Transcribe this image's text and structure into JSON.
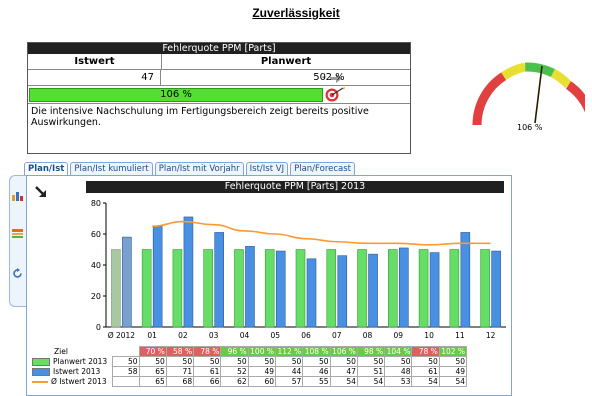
{
  "page_title": "Zuverlässigkeit",
  "kpi": {
    "header": "Fehlerquote PPM [Parts]",
    "col_istwert": "Istwert",
    "col_planwert": "Planwert",
    "istwert": "47",
    "planwert": "50",
    "delta": "-2 %",
    "progress_label": "106 %",
    "progress_fraction": 1.0,
    "comment": "Die intensive Nachschulung im Fertigungsbereich zeigt bereits positive Auswirkungen."
  },
  "gauge": {
    "label": "106 %",
    "value_percent": 106,
    "colors": {
      "red": "#e04040",
      "yellow": "#e8e030",
      "green": "#4cc04c"
    }
  },
  "tabs": [
    "Plan/Ist",
    "Plan/Ist kumuliert",
    "Plan/Ist mit Vorjahr",
    "Ist/Ist VJ",
    "Plan/Forecast"
  ],
  "active_tab": "Plan/Ist",
  "chart_data": {
    "type": "bar",
    "title": "Fehlerquote PPM [Parts] 2013",
    "categories": [
      "Ø 2012",
      "01",
      "02",
      "03",
      "04",
      "05",
      "06",
      "07",
      "08",
      "09",
      "10",
      "11",
      "12"
    ],
    "ylim": [
      0,
      80
    ],
    "yticks": [
      0,
      20,
      40,
      60,
      80
    ],
    "series": [
      {
        "name": "Planwert 2013",
        "color": "#66dd66",
        "values": [
          50,
          50,
          50,
          50,
          50,
          50,
          50,
          50,
          50,
          50,
          50,
          50,
          50
        ]
      },
      {
        "name": "Istwert 2013",
        "color": "#4a90e2",
        "values": [
          58,
          65,
          71,
          61,
          52,
          49,
          44,
          46,
          47,
          51,
          48,
          61,
          49
        ]
      },
      {
        "name": "Ø Istwert 2013",
        "color": "#ff9933",
        "type": "line",
        "values": [
          null,
          65,
          68,
          66,
          62,
          60,
          57,
          55,
          54,
          54,
          53,
          54,
          54
        ]
      }
    ],
    "ziel": {
      "label": "Ziel",
      "values": [
        "",
        "70 %",
        "58 %",
        "78 %",
        "96 %",
        "100 %",
        "112 %",
        "108 %",
        "106 %",
        "98 %",
        "104 %",
        "78 %",
        "102 %"
      ],
      "status": [
        "none",
        "red",
        "red",
        "red",
        "green",
        "green",
        "green",
        "green",
        "green",
        "green",
        "green",
        "red",
        "green"
      ]
    },
    "table_rows": [
      {
        "label": "Planwert 2013",
        "values": [
          "50",
          "50",
          "50",
          "50",
          "50",
          "50",
          "50",
          "50",
          "50",
          "50",
          "50",
          "50",
          "50"
        ]
      },
      {
        "label": "Istwert 2013",
        "values": [
          "58",
          "65",
          "71",
          "61",
          "52",
          "49",
          "44",
          "46",
          "47",
          "51",
          "48",
          "61",
          "49"
        ]
      },
      {
        "label": "Ø Istwert 2013",
        "values": [
          "",
          "65",
          "68",
          "66",
          "62",
          "60",
          "57",
          "55",
          "54",
          "54",
          "53",
          "54",
          "54"
        ]
      }
    ]
  }
}
